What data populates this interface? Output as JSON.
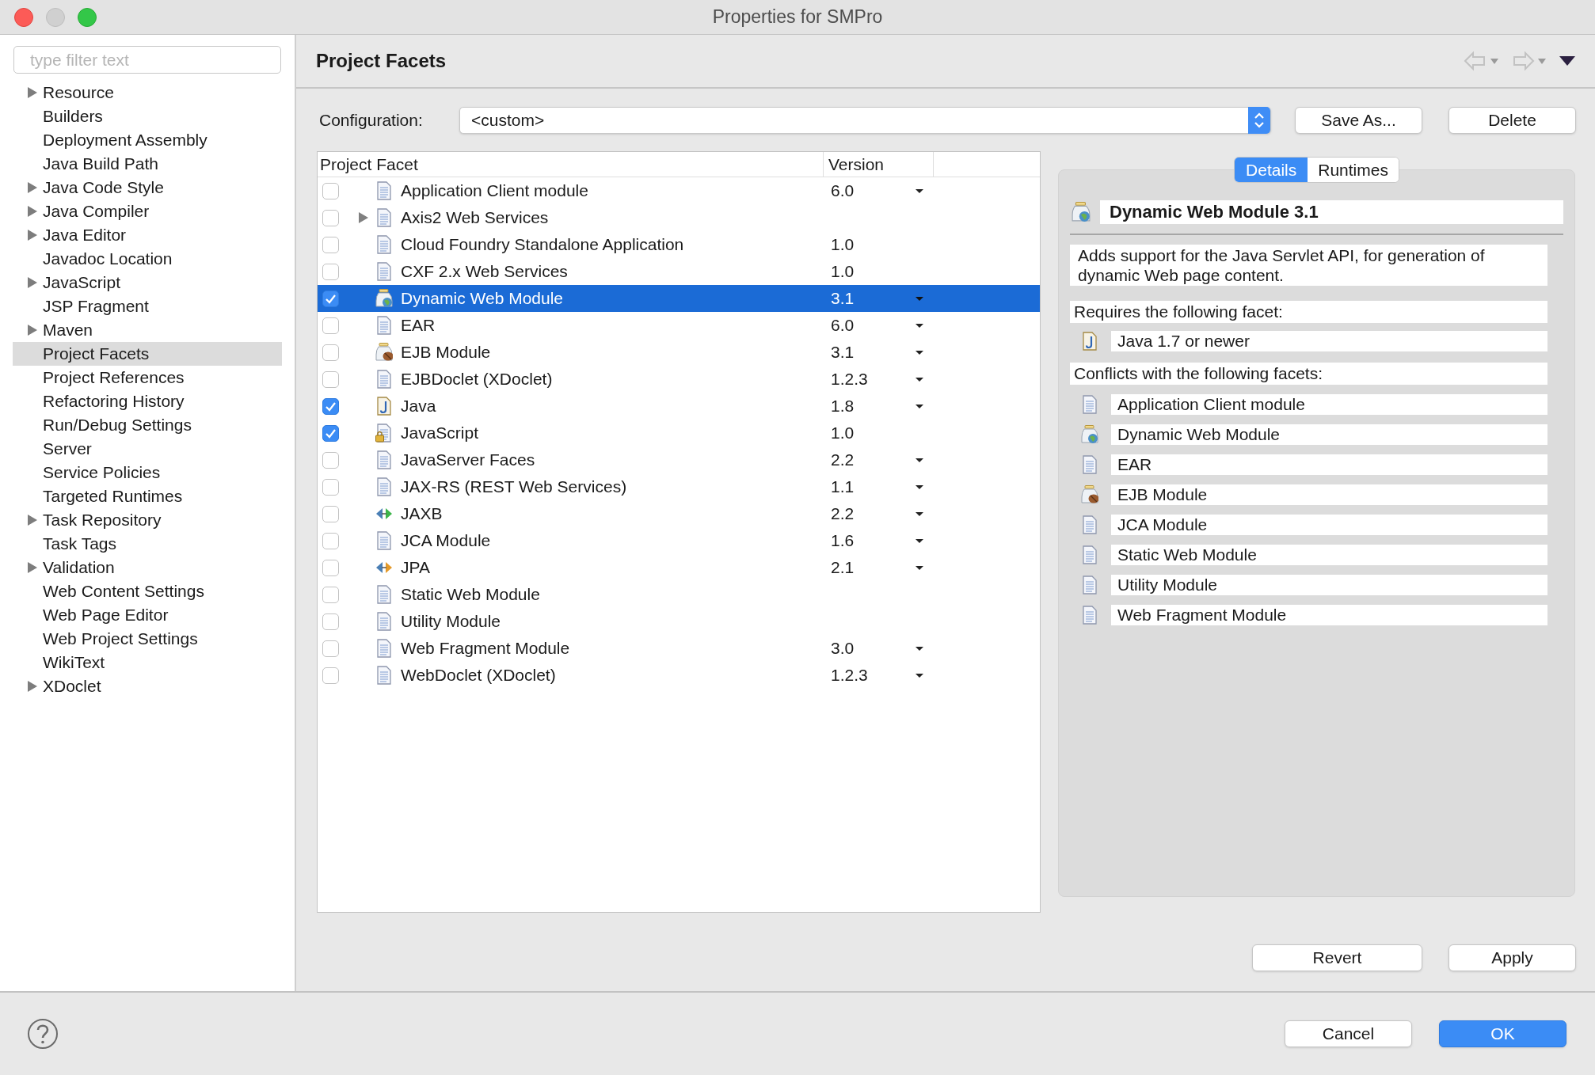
{
  "window": {
    "title": "Properties for SMPro"
  },
  "sidebar": {
    "filter_placeholder": "type filter text",
    "items": [
      {
        "label": "Resource",
        "expandable": true,
        "selected": false
      },
      {
        "label": "Builders",
        "expandable": false,
        "selected": false
      },
      {
        "label": "Deployment Assembly",
        "expandable": false,
        "selected": false
      },
      {
        "label": "Java Build Path",
        "expandable": false,
        "selected": false
      },
      {
        "label": "Java Code Style",
        "expandable": true,
        "selected": false
      },
      {
        "label": "Java Compiler",
        "expandable": true,
        "selected": false
      },
      {
        "label": "Java Editor",
        "expandable": true,
        "selected": false
      },
      {
        "label": "Javadoc Location",
        "expandable": false,
        "selected": false
      },
      {
        "label": "JavaScript",
        "expandable": true,
        "selected": false
      },
      {
        "label": "JSP Fragment",
        "expandable": false,
        "selected": false
      },
      {
        "label": "Maven",
        "expandable": true,
        "selected": false
      },
      {
        "label": "Project Facets",
        "expandable": false,
        "selected": true
      },
      {
        "label": "Project References",
        "expandable": false,
        "selected": false
      },
      {
        "label": "Refactoring History",
        "expandable": false,
        "selected": false
      },
      {
        "label": "Run/Debug Settings",
        "expandable": false,
        "selected": false
      },
      {
        "label": "Server",
        "expandable": false,
        "selected": false
      },
      {
        "label": "Service Policies",
        "expandable": false,
        "selected": false
      },
      {
        "label": "Targeted Runtimes",
        "expandable": false,
        "selected": false
      },
      {
        "label": "Task Repository",
        "expandable": true,
        "selected": false
      },
      {
        "label": "Task Tags",
        "expandable": false,
        "selected": false
      },
      {
        "label": "Validation",
        "expandable": true,
        "selected": false
      },
      {
        "label": "Web Content Settings",
        "expandable": false,
        "selected": false
      },
      {
        "label": "Web Page Editor",
        "expandable": false,
        "selected": false
      },
      {
        "label": "Web Project Settings",
        "expandable": false,
        "selected": false
      },
      {
        "label": "WikiText",
        "expandable": false,
        "selected": false
      },
      {
        "label": "XDoclet",
        "expandable": true,
        "selected": false
      }
    ]
  },
  "page": {
    "title": "Project Facets",
    "configuration_label": "Configuration:",
    "configuration_value": "<custom>",
    "buttons": [
      "Save As...",
      "Delete"
    ]
  },
  "table": {
    "columns": [
      "Project Facet",
      "Version"
    ],
    "rows": [
      {
        "facet": "Application Client module",
        "version": "6.0",
        "kind": "document",
        "checked": false,
        "selected": false,
        "collapsed": false,
        "version_menu": true
      },
      {
        "facet": "Axis2 Web Services",
        "kind": "document",
        "checked": false,
        "selected": false,
        "collapsed": true,
        "version_menu": false
      },
      {
        "facet": "Cloud Foundry Standalone Application",
        "version": "1.0",
        "kind": "document",
        "checked": false,
        "selected": false,
        "collapsed": false,
        "version_menu": false
      },
      {
        "facet": "CXF 2.x Web Services",
        "version": "1.0",
        "kind": "document",
        "checked": false,
        "selected": false,
        "collapsed": false,
        "version_menu": false
      },
      {
        "facet": "Dynamic Web Module",
        "version": "3.1",
        "kind": "web-module",
        "checked": true,
        "selected": true,
        "collapsed": false,
        "version_menu": true
      },
      {
        "facet": "EAR",
        "version": "6.0",
        "kind": "document",
        "checked": false,
        "selected": false,
        "collapsed": false,
        "version_menu": true
      },
      {
        "facet": "EJB Module",
        "version": "3.1",
        "kind": "ejb",
        "checked": false,
        "selected": false,
        "collapsed": false,
        "version_menu": true
      },
      {
        "facet": "EJBDoclet (XDoclet)",
        "version": "1.2.3",
        "kind": "document",
        "checked": false,
        "selected": false,
        "collapsed": false,
        "version_menu": true
      },
      {
        "facet": "Java",
        "version": "1.8",
        "kind": "java",
        "checked": true,
        "selected": false,
        "collapsed": false,
        "version_menu": true
      },
      {
        "facet": "JavaScript",
        "version": "1.0",
        "kind": "javascript",
        "checked": true,
        "selected": false,
        "collapsed": false,
        "version_menu": false
      },
      {
        "facet": "JavaServer Faces",
        "version": "2.2",
        "kind": "document",
        "checked": false,
        "selected": false,
        "collapsed": false,
        "version_menu": true
      },
      {
        "facet": "JAX-RS (REST Web Services)",
        "version": "1.1",
        "kind": "document",
        "checked": false,
        "selected": false,
        "collapsed": false,
        "version_menu": true
      },
      {
        "facet": "JAXB",
        "version": "2.2",
        "kind": "jaxb",
        "checked": false,
        "selected": false,
        "collapsed": false,
        "version_menu": true
      },
      {
        "facet": "JCA Module",
        "version": "1.6",
        "kind": "document",
        "checked": false,
        "selected": false,
        "collapsed": false,
        "version_menu": true
      },
      {
        "facet": "JPA",
        "version": "2.1",
        "kind": "jpa",
        "checked": false,
        "selected": false,
        "collapsed": false,
        "version_menu": true
      },
      {
        "facet": "Static Web Module",
        "kind": "document",
        "checked": false,
        "selected": false,
        "collapsed": false,
        "version_menu": false
      },
      {
        "facet": "Utility Module",
        "kind": "document",
        "checked": false,
        "selected": false,
        "collapsed": false,
        "version_menu": false
      },
      {
        "facet": "Web Fragment Module",
        "version": "3.0",
        "kind": "document",
        "checked": false,
        "selected": false,
        "collapsed": false,
        "version_menu": true
      },
      {
        "facet": "WebDoclet (XDoclet)",
        "version": "1.2.3",
        "kind": "document",
        "checked": false,
        "selected": false,
        "collapsed": false,
        "version_menu": true
      }
    ]
  },
  "details": {
    "tabs": [
      {
        "label": "Details",
        "selected": true
      },
      {
        "label": "Runtimes",
        "selected": false
      }
    ],
    "title": "Dynamic Web Module 3.1",
    "kind": "web-module",
    "description": "Adds support for the Java Servlet API, for generation of dynamic Web page content.",
    "requires_label": "Requires the following facet:",
    "requires": [
      {
        "label": "Java 1.7 or newer",
        "kind": "java"
      }
    ],
    "conflicts_label": "Conflicts with the following facets:",
    "conflicts": [
      {
        "label": "Application Client module",
        "kind": "document"
      },
      {
        "label": "Dynamic Web Module",
        "kind": "web-module"
      },
      {
        "label": "EAR",
        "kind": "document"
      },
      {
        "label": "EJB Module",
        "kind": "ejb"
      },
      {
        "label": "JCA Module",
        "kind": "document"
      },
      {
        "label": "Static Web Module",
        "kind": "document"
      },
      {
        "label": "Utility Module",
        "kind": "document"
      },
      {
        "label": "Web Fragment Module",
        "kind": "document"
      }
    ]
  },
  "page_buttons": [
    "Revert",
    "Apply"
  ],
  "footer": {
    "buttons": [
      {
        "label": "Cancel",
        "kind": "normal"
      },
      {
        "label": "OK",
        "kind": "default"
      }
    ]
  }
}
